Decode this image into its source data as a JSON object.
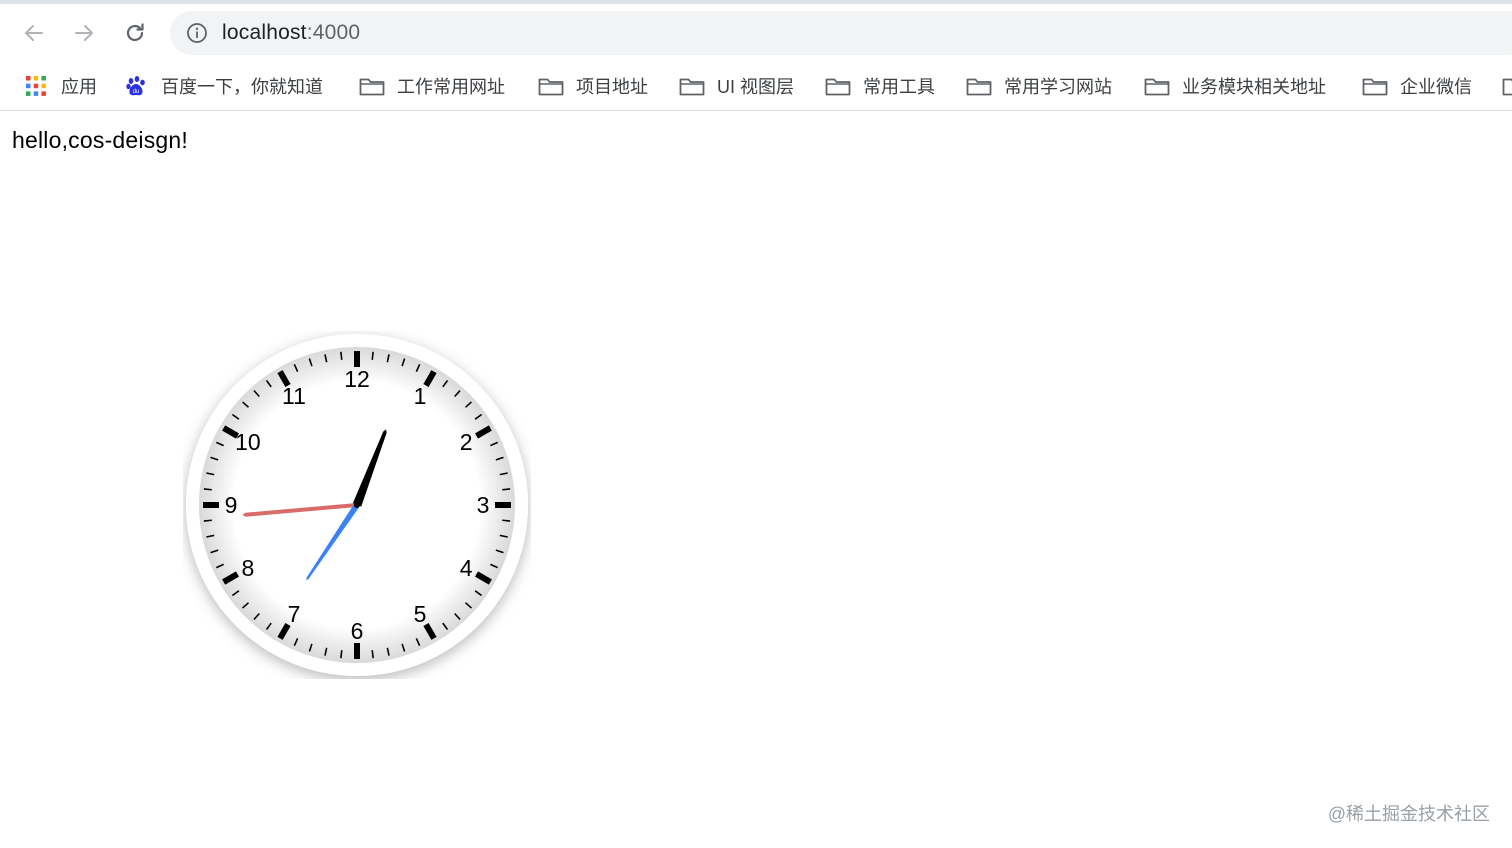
{
  "browser": {
    "url_host": "localhost",
    "url_port": ":4000",
    "nav": {
      "back_icon": "arrow-left-icon",
      "forward_icon": "arrow-right-icon",
      "reload_icon": "reload-icon",
      "info_icon": "info-icon"
    }
  },
  "bookmarks": [
    {
      "label": "应用",
      "icon": "apps-grid-icon"
    },
    {
      "label": "百度一下，你就知道",
      "icon": "baidu-paw-icon"
    },
    {
      "label": "工作常用网址",
      "icon": "folder-icon"
    },
    {
      "label": "项目地址",
      "icon": "folder-icon"
    },
    {
      "label": "UI 视图层",
      "icon": "folder-icon"
    },
    {
      "label": "常用工具",
      "icon": "folder-icon"
    },
    {
      "label": "常用学习网站",
      "icon": "folder-icon"
    },
    {
      "label": "业务模块相关地址",
      "icon": "folder-icon"
    },
    {
      "label": "企业微信",
      "icon": "folder-icon"
    }
  ],
  "page": {
    "greeting": "hello,cos-deisgn!",
    "watermark": "@稀土掘金技术社区"
  },
  "clock": {
    "numerals": [
      "12",
      "1",
      "2",
      "3",
      "4",
      "5",
      "6",
      "7",
      "8",
      "9",
      "10",
      "11"
    ],
    "time": {
      "hour": 1,
      "minute": 2,
      "second": 47
    },
    "colors": {
      "hour_hand": "#000000",
      "minute_hand": "#000000",
      "second_hand": "#3b82f6",
      "red_hand": "#d96b6b"
    }
  }
}
